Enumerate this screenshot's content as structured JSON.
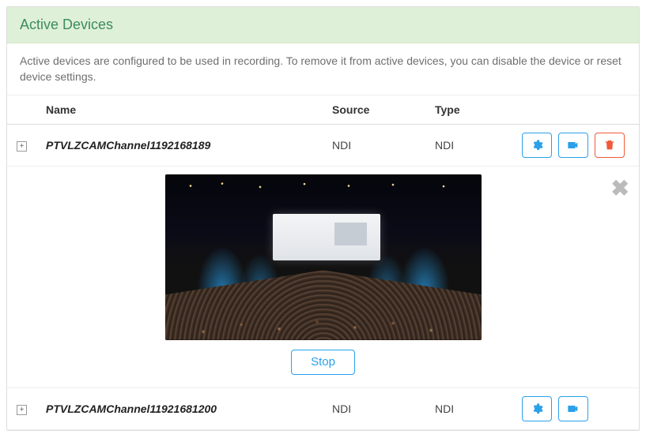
{
  "panel": {
    "title": "Active Devices",
    "description": "Active devices are configured to be used in recording. To remove it from active devices, you can disable the device or reset device settings."
  },
  "table": {
    "headers": {
      "name": "Name",
      "source": "Source",
      "type": "Type"
    }
  },
  "devices": [
    {
      "name": "PTVLZCAMChannel1192168189",
      "source": "NDI",
      "type": "NDI",
      "has_delete": true
    },
    {
      "name": "PTVLZCAMChannel11921681200",
      "source": "NDI",
      "type": "NDI",
      "has_delete": false
    }
  ],
  "preview": {
    "stop_label": "Stop",
    "alt": "conference-hall-preview"
  },
  "icons": {
    "expand": "⊞",
    "close": "✖"
  }
}
